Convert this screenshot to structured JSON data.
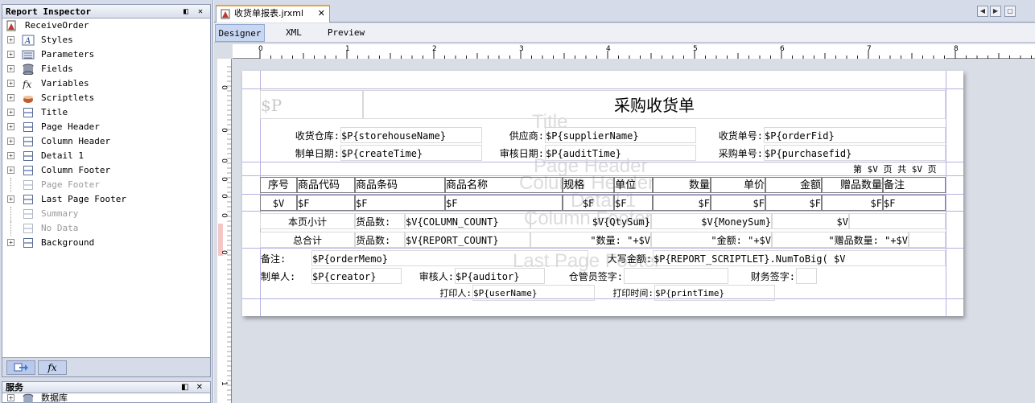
{
  "inspector": {
    "title": "Report Inspector",
    "title_buttons": "◧ ✕",
    "root": "ReceiveOrder",
    "items": [
      {
        "label": "Styles",
        "disabled": false
      },
      {
        "label": "Parameters",
        "disabled": false
      },
      {
        "label": "Fields",
        "disabled": false
      },
      {
        "label": "Variables",
        "disabled": false
      },
      {
        "label": "Scriptlets",
        "disabled": false
      },
      {
        "label": "Title",
        "disabled": false
      },
      {
        "label": "Page Header",
        "disabled": false
      },
      {
        "label": "Column Header",
        "disabled": false
      },
      {
        "label": "Detail 1",
        "disabled": false
      },
      {
        "label": "Column Footer",
        "disabled": false
      },
      {
        "label": "Page Footer",
        "disabled": true
      },
      {
        "label": "Last Page Footer",
        "disabled": false
      },
      {
        "label": "Summary",
        "disabled": true
      },
      {
        "label": "No Data",
        "disabled": true
      },
      {
        "label": "Background",
        "disabled": false
      }
    ],
    "tab_icons": [
      "arrow-icon",
      "fx-icon"
    ]
  },
  "services": {
    "title": "服务",
    "first_item": "数据库"
  },
  "editor": {
    "file_tab": "收货单报表.jrxml",
    "close": "✕",
    "subtabs": [
      "Designer",
      "XML",
      "Preview"
    ],
    "active_subtab": "Designer",
    "nav_left": "◀",
    "nav_right": "▶",
    "nav_menu": "▢"
  },
  "ruler": {
    "h_labels": [
      "0",
      "1",
      "2",
      "3",
      "4",
      "5",
      "6",
      "7",
      "8"
    ],
    "v_labels": [
      "0",
      "0",
      "0",
      "0",
      "0",
      "0",
      "0",
      "1"
    ]
  },
  "report": {
    "band_labels": {
      "title": "Title",
      "page_header": "Page Header",
      "column_header": "Column Header",
      "detail": "Detail 1",
      "column_footer": "Column Footer",
      "last_page_footer": "Last Page Footer"
    },
    "logo_param": "$P",
    "title_text": "采购收货单",
    "header_fields": {
      "storehouse_label": "收货仓库:",
      "storehouse_value": "$P{storehouseName}",
      "supplier_label": "供应商:",
      "supplier_value": "$P{supplierName}",
      "order_no_label": "收货单号:",
      "order_no_value": "$P{orderFid}",
      "create_date_label": "制单日期:",
      "create_date_value": "$P{createTime}",
      "audit_date_label": "审核日期:",
      "audit_date_value": "$P{auditTime}",
      "purchase_no_label": "采购单号:",
      "purchase_no_value": "$P{purchasefid}"
    },
    "page_counter": {
      "page_prefix": "第",
      "page_var": "$V",
      "page_suffix": "页",
      "total_prefix": "共",
      "total_var": "$V",
      "total_suffix": "页"
    },
    "columns": [
      "序号",
      "商品代码",
      "商品条码",
      "商品名称",
      "规格",
      "单位",
      "数量",
      "单价",
      "金额",
      "赠品数量",
      "备注"
    ],
    "detail_row": [
      "$V",
      "$F",
      "$F",
      "$F",
      "$F",
      "$F",
      "$F",
      "$F",
      "$F",
      "$F",
      "$F"
    ],
    "page_subtotal": {
      "label": "本页小计",
      "count_label": "货品数:",
      "count_value": "$V{COLUMN_COUNT}",
      "qty": "$V{QtySum}",
      "money": "$V{MoneySum}",
      "gift": "$V"
    },
    "grand_total": {
      "label": "总合计",
      "count_label": "货品数:",
      "count_value": "$V{REPORT_COUNT}",
      "qty": "\"数量: \"+$V",
      "money": "\"金额: \"+$V",
      "gift": "\"赠品数量: \"+$V"
    },
    "footer": {
      "memo_label": "备注:",
      "memo_value": "$P{orderMemo}",
      "amount_label": "大写金额:",
      "amount_value": "$P{REPORT_SCRIPTLET}.NumToBig( $V",
      "creator_label": "制单人:",
      "creator_value": "$P{creator}",
      "auditor_label": "审核人:",
      "auditor_value": "$P{auditor}",
      "keeper_label": "仓管员签字:",
      "finance_label": "财务签字:",
      "printer_label": "打印人:",
      "printer_value": "$P{userName}",
      "print_time_label": "打印时间:",
      "print_time_value": "$P{printTime}"
    }
  }
}
